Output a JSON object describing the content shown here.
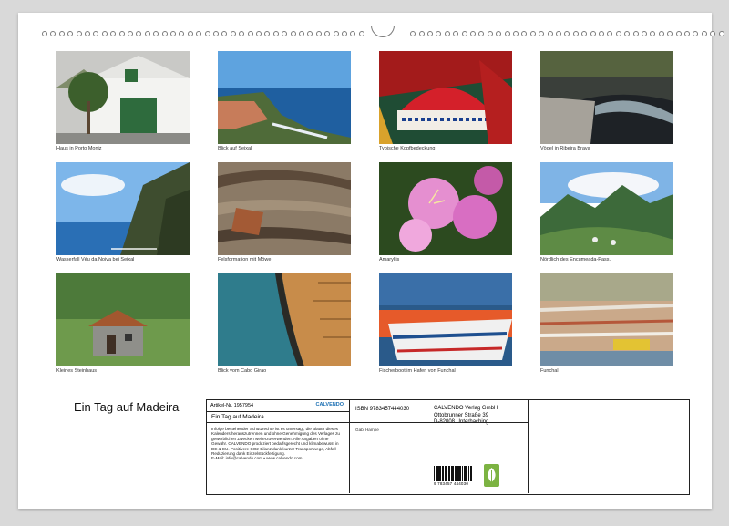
{
  "photos": [
    {
      "caption": "Haus in Porto Moniz",
      "scene": "white-house"
    },
    {
      "caption": "Blick auf Seixal",
      "scene": "coast-village"
    },
    {
      "caption": "Typische Kopfbedeckung",
      "scene": "red-hat"
    },
    {
      "caption": "Vögel in Ribeira Brava",
      "scene": "river-birds"
    },
    {
      "caption": "Wasserfall Véu da Noiva bei Seixal",
      "scene": "cliff-sea"
    },
    {
      "caption": "Felsformation mit Möwe",
      "scene": "rock-layers"
    },
    {
      "caption": "Amaryllis",
      "scene": "pink-flowers"
    },
    {
      "caption": "Nördlich des Encumeada-Pass.",
      "scene": "mountains"
    },
    {
      "caption": "Kleines Steinhaus",
      "scene": "stone-house"
    },
    {
      "caption": "Blick vom Cabo Girao",
      "scene": "aerial-coast"
    },
    {
      "caption": "Fischerboot im Hafen von Funchal",
      "scene": "fishing-boat"
    },
    {
      "caption": "Funchal",
      "scene": "city"
    }
  ],
  "calendar_title": "Ein Tag auf Madeira",
  "info": {
    "article_no": "Artikel-Nr. 1957954",
    "logo_text": "CALVENDO",
    "logo_sub": "",
    "product_title": "Ein Tag auf Madeira",
    "legal": "Infolge bestehender Schutzrechte ist es untersagt, die Blätter dieses Kalenders herauszutrennen und ohne Genehmigung des Verlages zu gewerblichen Zwecken weiterzuverwenden. Alle Angaben ohne Gewähr. CALVENDO produziert bedarfsgerecht und klimabewusst in DE & EU. Positivere CO2-Bilanz dank kurzer Transportwege, Abfall-Reduzierung dank Einzelstückfertigung.",
    "email": "E-Mail: info@calvendo.com • www.calvendo.com",
    "isbn": "ISBN 9783457444030",
    "publisher_name": "CALVENDO Verlag GmbH",
    "publisher_street": "Ottobrunner Straße 39",
    "publisher_city": "D-82008 Unterhaching",
    "author": "Gabi Hampe",
    "barcode_number": "9 783457 444030"
  }
}
